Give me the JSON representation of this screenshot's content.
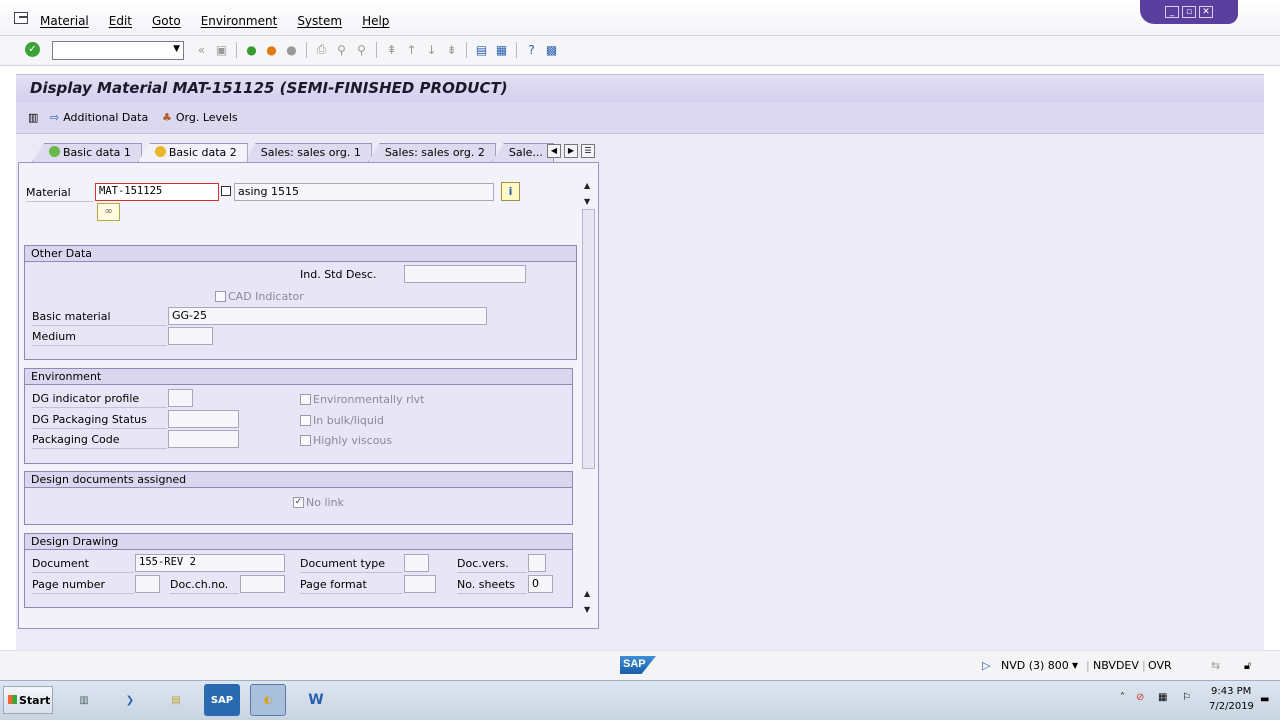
{
  "menu": {
    "items": [
      "Material",
      "Edit",
      "Goto",
      "Environment",
      "System",
      "Help"
    ]
  },
  "toolbar": {
    "command_value": "",
    "nav_back": "«"
  },
  "title": "Display Material MAT-151125 (SEMI-FINISHED PRODUCT)",
  "app_toolbar": {
    "additional_data": "Additional Data",
    "org_levels": "Org. Levels"
  },
  "tabs": [
    {
      "label": "Basic data 1",
      "active": false
    },
    {
      "label": "Basic data 2",
      "active": true
    },
    {
      "label": "Sales: sales org. 1",
      "active": false
    },
    {
      "label": "Sales: sales org. 2",
      "active": false
    },
    {
      "label": "Sale...",
      "active": false
    }
  ],
  "material": {
    "label": "Material",
    "number": "MAT-151125",
    "description": "asing 1515"
  },
  "other_data": {
    "header": "Other Data",
    "ind_std_desc_label": "Ind. Std Desc.",
    "ind_std_desc_value": "",
    "cad_indicator_label": "CAD Indicator",
    "basic_material_label": "Basic material",
    "basic_material_value": "GG-25",
    "medium_label": "Medium",
    "medium_value": ""
  },
  "environment": {
    "header": "Environment",
    "dg_indicator_label": "DG indicator profile",
    "dg_packaging_label": "DG Packaging Status",
    "packaging_code_label": "Packaging Code",
    "env_rlvt_label": "Environmentally rlvt",
    "bulk_label": "In bulk/liquid",
    "viscous_label": "Highly viscous"
  },
  "design_docs": {
    "header": "Design documents assigned",
    "no_link_label": "No link",
    "no_link_checked": true
  },
  "design_drawing": {
    "header": "Design Drawing",
    "document_label": "Document",
    "document_value": "155-REV 2",
    "document_type_label": "Document type",
    "doc_vers_label": "Doc.vers.",
    "page_number_label": "Page number",
    "doc_ch_no_label": "Doc.ch.no.",
    "page_format_label": "Page format",
    "no_sheets_label": "No. sheets",
    "no_sheets_value": "0"
  },
  "status": {
    "sap_logo": "SAP",
    "system": "NVD (3) 800",
    "server": "NBVDEV",
    "mode": "OVR"
  },
  "taskbar": {
    "start": "Start",
    "sap_task": "SAP",
    "word_task": "W",
    "time": "9:43 PM",
    "date": "7/2/2019"
  }
}
